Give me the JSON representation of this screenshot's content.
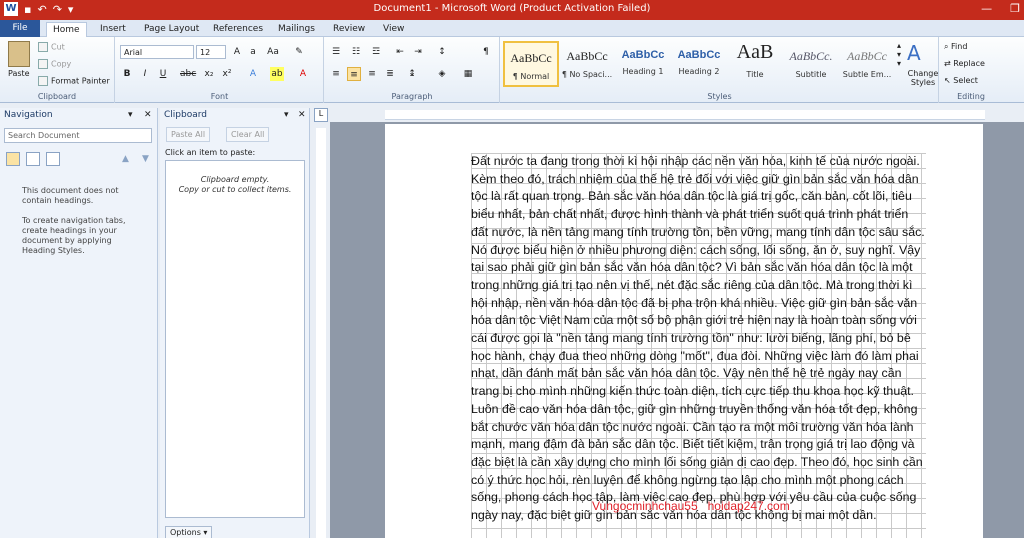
{
  "titlebar": {
    "title": "Document1 - Microsoft Word (Product Activation Failed)",
    "minimize": "—",
    "restore": "❐",
    "close": "✕"
  },
  "tabs": [
    "File",
    "Home",
    "Insert",
    "Page Layout",
    "References",
    "Mailings",
    "Review",
    "View"
  ],
  "clipboard_group": {
    "paste": "Paste",
    "cut": "Cut",
    "copy": "Copy",
    "format_painter": "Format Painter",
    "label": "Clipboard"
  },
  "font_group": {
    "font_name": "Arial",
    "font_size": "12",
    "label": "Font"
  },
  "paragraph_group": {
    "label": "Paragraph"
  },
  "styles_group": {
    "label": "Styles",
    "items": [
      {
        "sample": "AaBbCc",
        "name": "¶ Normal"
      },
      {
        "sample": "AaBbCc",
        "name": "¶ No Spaci..."
      },
      {
        "sample": "AaBbCc",
        "name": "Heading 1"
      },
      {
        "sample": "AaBbCc",
        "name": "Heading 2"
      },
      {
        "sample": "AaB",
        "name": "Title"
      },
      {
        "sample": "AaBbCc.",
        "name": "Subtitle"
      },
      {
        "sample": "AaBbCc",
        "name": "Subtle Em..."
      }
    ],
    "change_styles": "Change Styles"
  },
  "editing_group": {
    "find": "Find",
    "replace": "Replace",
    "select": "Select",
    "label": "Editing"
  },
  "navigation": {
    "title": "Navigation",
    "search_placeholder": "Search Document",
    "msg1": "This document does not contain headings.",
    "msg2": "To create navigation tabs, create headings in your document by applying Heading Styles."
  },
  "clipboard_pane": {
    "title": "Clipboard",
    "paste_all": "Paste All",
    "clear_all": "Clear All",
    "click_label": "Click an item to paste:",
    "empty": "Clipboard empty.",
    "empty_hint": "Copy or cut to collect items.",
    "options": "Options"
  },
  "document": {
    "body": "Đất nước ta đang trong thời kì hội nhập các nền văn hóa, kinh tế của nước ngoài. Kèm theo đó, trách nhiệm của thế hệ trẻ đối với việc giữ gìn bản sắc văn hóa dân tộc là rất quan trọng. Bản sắc văn hóa dân tộc là giá trị gốc, căn bản, cốt lõi, tiêu biểu nhất, bản chất nhất, được hình thành và phát triển suốt quá trình phát triển đất nước, là nền tảng mang tính trường tồn, bền vững, mang tính dân tộc sâu sắc. Nó được biểu hiện ở nhiều phương diện: cách sống, lối sống, ăn ở, suy nghĩ. Vậy tại sao phải giữ gìn bản sắc văn hóa dân tộc? Vì bản sắc văn hóa dân tộc là một trong những giá trị tạo nên vị thế, nét đặc sắc riêng của dân tộc. Mà trong thời kì hội nhập, nền văn hóa dân tộc đã bị pha trộn khá nhiều. Việc giữ gìn bản sắc văn hóa dân tộc Việt Nam của một số bộ phận giới trẻ hiện nay là hoàn toàn sống với cái được gọi là \"nền tảng mang tính trường tồn\" như: lười biếng, lãng phí, bỏ bê học hành, chạy đua theo những dòng \"mốt\", đua đòi. Những việc làm đó làm phai nhạt, dần đánh mất bản sắc văn hóa dân tộc. Vậy nên thế hệ trẻ ngày nay cần trang bị cho mình những kiến thức toàn diện, tích cực tiếp thu khoa học kỹ thuật. Luôn đề cao văn hóa dân tộc, giữ gìn những truyền thống văn hóa tốt đẹp, không bắt chước văn hóa dân tộc nước ngoài. Cần tạo ra một môi trường văn hóa lành mạnh, mang đậm đà bản sắc dân tộc. Biết tiết kiệm, trân trọng giá trị lao động và đặc biệt là cần xây dựng cho mình lối sống giản dị cao đẹp. Theo đó, học sinh cần có ý thức học hỏi, rèn luyện để không ngừng tạo lập cho mình một phong cách sống, phong cách học tập, làm việc cao đẹp, phù hợp với yêu cầu của cuộc sống ngày nay, đặc biệt giữ gìn bản sắc văn hóa dân tộc không bị mai một dần.",
    "watermark": "Vungocminhchau55   hoidap247.com"
  }
}
